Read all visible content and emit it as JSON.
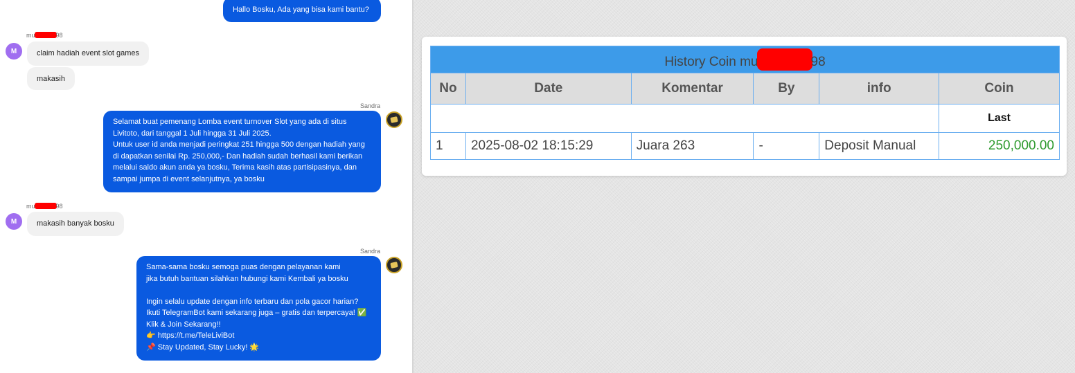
{
  "chat": {
    "messages": [
      {
        "type": "outgoing",
        "lines": [
          "Hallo Bosku, Ada yang bisa kami bantu?"
        ]
      },
      {
        "type": "incoming",
        "user_name_prefix": "mu",
        "user_name_suffix": "98",
        "avatar": "M",
        "bubbles": [
          "claim hadiah event slot games",
          "makasih"
        ]
      },
      {
        "type": "outgoing",
        "sender": "Sandra",
        "lines": [
          "Selamat buat pemenang Lomba event turnover Slot yang ada di situs",
          "Livitoto, dari tanggal 1 Juli hingga 31 Juli 2025.",
          "Untuk user id anda menjadi peringkat 251 hingga 500 dengan hadiah yang",
          "di dapatkan senilai Rp. 250,000,- Dan hadiah sudah berhasil kami berikan",
          "melalui saldo akun anda ya bosku, Terima kasih atas partisipasinya, dan",
          "sampai jumpa di event selanjutnya, ya bosku"
        ]
      },
      {
        "type": "incoming",
        "user_name_prefix": "mu",
        "user_name_suffix": "98",
        "avatar": "M",
        "bubbles": [
          "makasih banyak bosku"
        ]
      },
      {
        "type": "outgoing",
        "sender": "Sandra",
        "lines": [
          "Sama-sama bosku semoga puas dengan pelayanan kami",
          "jika butuh bantuan silahkan hubungi kami Kembali ya bosku",
          "",
          "Ingin selalu update dengan info terbaru dan pola gacor harian?",
          "Ikuti TelegramBot kami sekarang juga – gratis dan terpercaya! ✅",
          "Klik & Join Sekarang!!",
          "👉 https://t.me/TeleLiviBot",
          "📌 Stay Updated, Stay Lucky! 🌟"
        ]
      }
    ]
  },
  "history": {
    "title_prefix": "History Coin mu",
    "title_suffix": "98",
    "columns": [
      "No",
      "Date",
      "Komentar",
      "By",
      "info",
      "Coin"
    ],
    "last_label": "Last",
    "rows": [
      {
        "no": "1",
        "date": "2025-08-02 18:15:29",
        "komentar": "Juara 263",
        "by": "-",
        "info": "Deposit Manual",
        "coin": "250,000.00"
      }
    ]
  },
  "colors": {
    "chat_bubble_out": "#0a5ae0",
    "chat_bubble_in": "#f1f1f1",
    "table_header": "#3d9be9",
    "coin_positive": "#2e9a2e",
    "redaction": "#ff0000"
  }
}
